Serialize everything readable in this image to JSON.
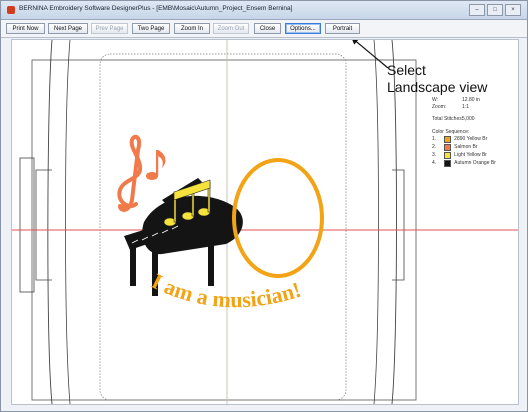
{
  "window": {
    "title": "BERNINA Embroidery Software DesignerPlus - [EMB\\Mosaic\\Autumn_Project_Ensem    Bernina]",
    "controls": [
      "–",
      "□",
      "×"
    ]
  },
  "toolbar": {
    "buttons": [
      {
        "label": "Print Now",
        "enabled": true
      },
      {
        "label": "Next Page",
        "enabled": true
      },
      {
        "label": "Prev Page",
        "enabled": false
      },
      {
        "label": "Two Page",
        "enabled": true
      },
      {
        "label": "Zoom In",
        "enabled": true
      },
      {
        "label": "Zoom Out",
        "enabled": false
      },
      {
        "label": "Close",
        "enabled": true
      },
      {
        "label": "Options...",
        "enabled": true
      },
      {
        "label": "Portrait",
        "enabled": true
      }
    ]
  },
  "design": {
    "text": "I am a musician!",
    "colors": {
      "text": "#f2a316",
      "notes": "#f07a4a",
      "yellow_notes": "#f5e23a",
      "ring": "#f2a316",
      "piano": "#141414"
    }
  },
  "info_panel": {
    "rows": [
      {
        "key": "W:",
        "value": "12.80 in"
      },
      {
        "key": "Zoom:",
        "value": "1:1"
      },
      {
        "key": "Total Stitches:",
        "value": "5,000"
      }
    ],
    "colors_heading": "Color Sequence:",
    "colors": [
      {
        "num": "1.",
        "swatch": "#f2a316",
        "text": "2890 Yellow Br"
      },
      {
        "num": "2.",
        "swatch": "#f07a4a",
        "text": "Salmon Br"
      },
      {
        "num": "3.",
        "swatch": "#f5e23a",
        "text": "Light Yellow Br"
      },
      {
        "num": "4.",
        "swatch": "#141414",
        "text": "Autumn Orange Br"
      }
    ]
  },
  "callout": {
    "line1": "Select",
    "line2": "Landscape view"
  }
}
